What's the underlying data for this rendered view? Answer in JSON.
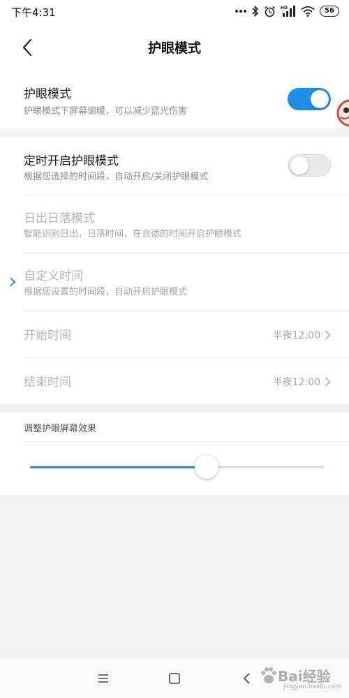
{
  "status_bar": {
    "time": "下午4:31",
    "battery": "56",
    "icons": [
      "more-dots-icon",
      "bluetooth-icon",
      "alarm-icon",
      "hd-signal-icon",
      "wifi-icon",
      "battery-icon"
    ]
  },
  "header": {
    "title": "护眼模式",
    "back_icon": "chevron-left-icon"
  },
  "eye_mode": {
    "title": "护眼模式",
    "subtitle": "护眼模式下屏幕偏暖，可以减少蓝光伤害",
    "enabled": true
  },
  "schedule": {
    "title": "定时开启护眼模式",
    "subtitle": "根据您选择的时间段，自动开启/关闭护眼模式",
    "enabled": false
  },
  "sunrise": {
    "title": "日出日落模式",
    "subtitle": "智能识别日出，日落时间，在合适的时间开启护眼模式"
  },
  "custom_time": {
    "title": "自定义时间",
    "subtitle": "根据您设置的时间段，自动开启护眼模式",
    "selected": true
  },
  "start_time": {
    "label": "开始时间",
    "value": "半夜12:00"
  },
  "end_time": {
    "label": "结束时间",
    "value": "半夜12:00"
  },
  "adjust": {
    "label": "调整护眼屏幕效果",
    "level": 0.6
  },
  "nav": {
    "icons": [
      "menu-icon",
      "home-icon",
      "back-icon"
    ]
  },
  "watermark": {
    "text": "Bai经验",
    "url": "jingyan.baidu.com"
  },
  "colors": {
    "accent": "#1d8fe9",
    "background": "#f2f2f2",
    "disabled_text": "#b7b7b7"
  }
}
